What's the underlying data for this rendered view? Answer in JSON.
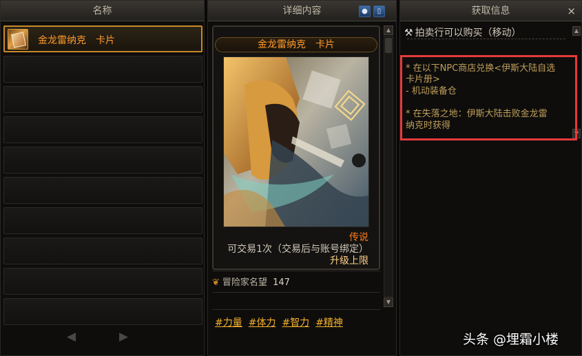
{
  "list_panel": {
    "header": "名称",
    "selected_item": {
      "name": "金龙雷纳克　卡片"
    },
    "empty_slots": 9,
    "prev_arrow": "◀",
    "next_arrow": "▶"
  },
  "detail_panel": {
    "header": "详细内容",
    "card_title": "金龙雷纳克　卡片",
    "rarity": "传说",
    "rarity_color": "#ff7a1a",
    "trade_info": "可交易1次（交易后与账号绑定）",
    "upgrade_info": "升级上限",
    "reputation_label": "冒险家名望",
    "reputation_value": "147",
    "tags": [
      "#力量",
      "#体力",
      "#智力",
      "#精神"
    ]
  },
  "source_panel": {
    "header": "获取信息",
    "close": "×",
    "auction_note": "拍卖行可以购买（移动）",
    "sources": [
      "* 在以下NPC商店兑换<伊斯大陆自选",
      "卡片册>",
      "- 机动装备仓",
      "",
      "* 在失落之地：伊斯大陆击败金龙雷",
      "纳克时获得"
    ],
    "highlight_color": "#e43a3a"
  },
  "watermark": "头条 @埋霜小楼"
}
